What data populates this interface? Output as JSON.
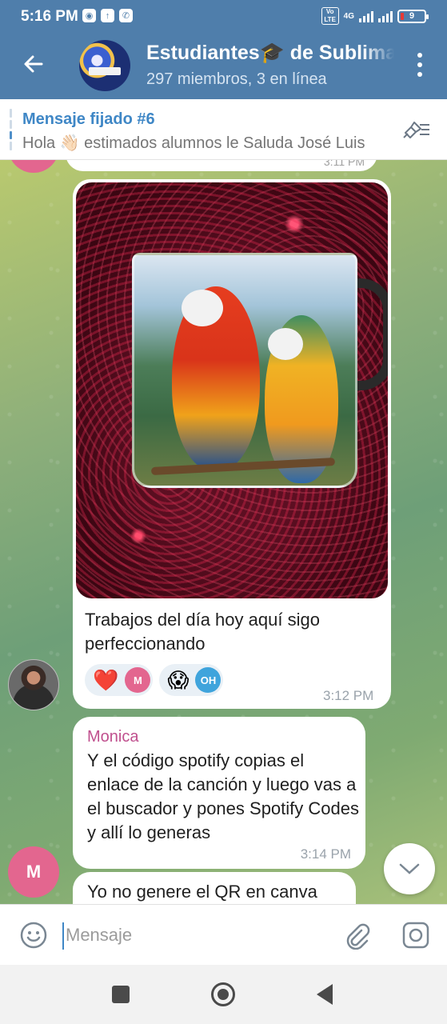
{
  "status": {
    "time": "5:16 PM",
    "network_label": "4G",
    "volte_label": "Vo LTE",
    "battery": "9"
  },
  "header": {
    "title": "Estudiantes🎓 de Sublimación",
    "subtitle": "297 miembros, 3 en línea"
  },
  "pinned": {
    "title": "Mensaje fijado #6",
    "text": "Hola 👋🏻 estimados alumnos le Saluda José Luis"
  },
  "messages": {
    "previous_time": "3:11 PM",
    "photo_caption": "Trabajos del día hoy aquí sigo perfeccionando",
    "reactions": [
      {
        "emoji": "❤️",
        "user_initials": "M",
        "color": "#e3668f"
      },
      {
        "emoji": "😱",
        "user_initials": "OH",
        "color": "#3fa4dc"
      }
    ],
    "photo_time": "3:12 PM",
    "monica": {
      "sender": "Monica",
      "text": "Y el código spotify copias el enlace de la canción y luego vas a el buscador y pones Spotify Codes y allí lo generas",
      "time": "3:14 PM",
      "avatar_initial": "M"
    },
    "last_text": "Yo no genere el QR en canva"
  },
  "input": {
    "placeholder": "Mensaje"
  },
  "colors": {
    "header_bg": "#4f7eab",
    "accent": "#3f87c6",
    "sender_color": "#c0508e"
  }
}
